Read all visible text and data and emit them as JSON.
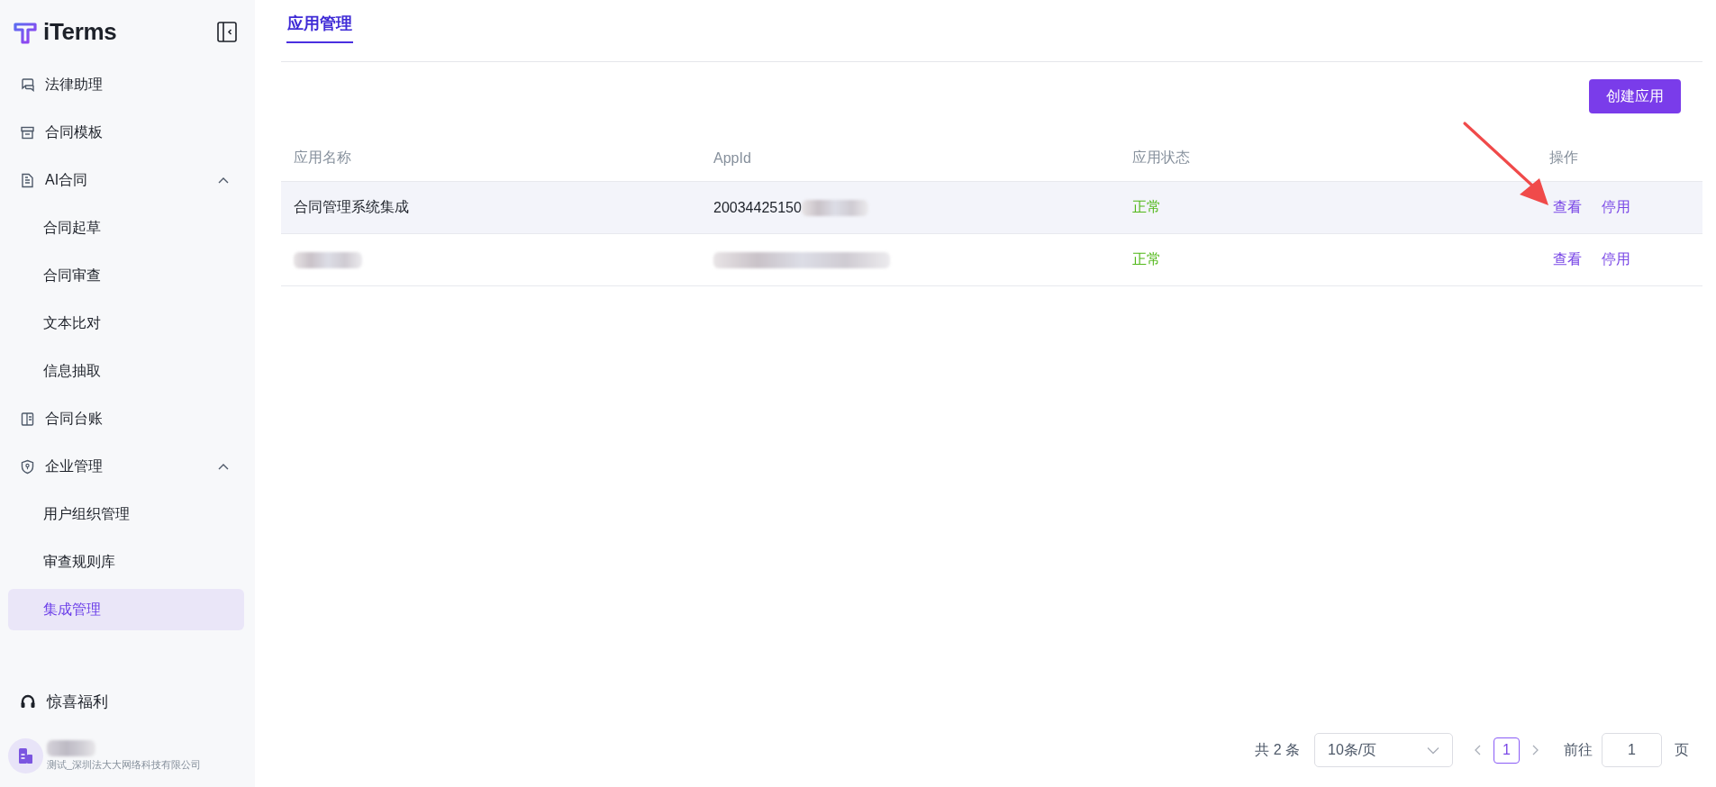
{
  "logo": {
    "text": "iTerms"
  },
  "sidebar": {
    "items": [
      {
        "label": "法律助理",
        "selected": false
      },
      {
        "label": "合同模板",
        "selected": false
      },
      {
        "label": "AI合同",
        "selected": false,
        "expanded": true,
        "children": [
          {
            "label": "合同起草",
            "selected": false
          },
          {
            "label": "合同审查",
            "selected": false
          },
          {
            "label": "文本比对",
            "selected": false
          },
          {
            "label": "信息抽取",
            "selected": false
          }
        ]
      },
      {
        "label": "合同台账",
        "selected": false
      },
      {
        "label": "企业管理",
        "selected": false,
        "expanded": true,
        "children": [
          {
            "label": "用户组织管理",
            "selected": false
          },
          {
            "label": "审查规则库",
            "selected": false
          },
          {
            "label": "集成管理",
            "selected": true
          }
        ]
      }
    ],
    "promo": {
      "label": "惊喜福利"
    },
    "account": {
      "name_redacted": true,
      "company": "测试_深圳法大大网络科技有限公司"
    }
  },
  "tabs": [
    {
      "label": "应用管理",
      "selected": true
    }
  ],
  "create_button": "创建应用",
  "table": {
    "columns": [
      "应用名称",
      "AppId",
      "应用状态",
      "操作"
    ],
    "rows": [
      {
        "highlighted": true,
        "name": {
          "text": "合同管理系统集成",
          "redacted": false
        },
        "app_id": {
          "text": "20034425150",
          "redacted": true
        },
        "status": "正常",
        "actions": [
          "查看",
          "停用"
        ]
      },
      {
        "highlighted": false,
        "name": {
          "redacted": true
        },
        "app_id": {
          "redacted": true
        },
        "status": "正常",
        "actions": [
          "查看",
          "停用"
        ]
      }
    ]
  },
  "pagination": {
    "total": "共 2 条",
    "page_size": "10条/页",
    "pages": [
      {
        "label": "1",
        "selected": true
      }
    ],
    "goto_label": "前往",
    "goto_value": "1",
    "page_suffix": "页"
  },
  "annotations": [
    {
      "kind": "arrow"
    }
  ]
}
